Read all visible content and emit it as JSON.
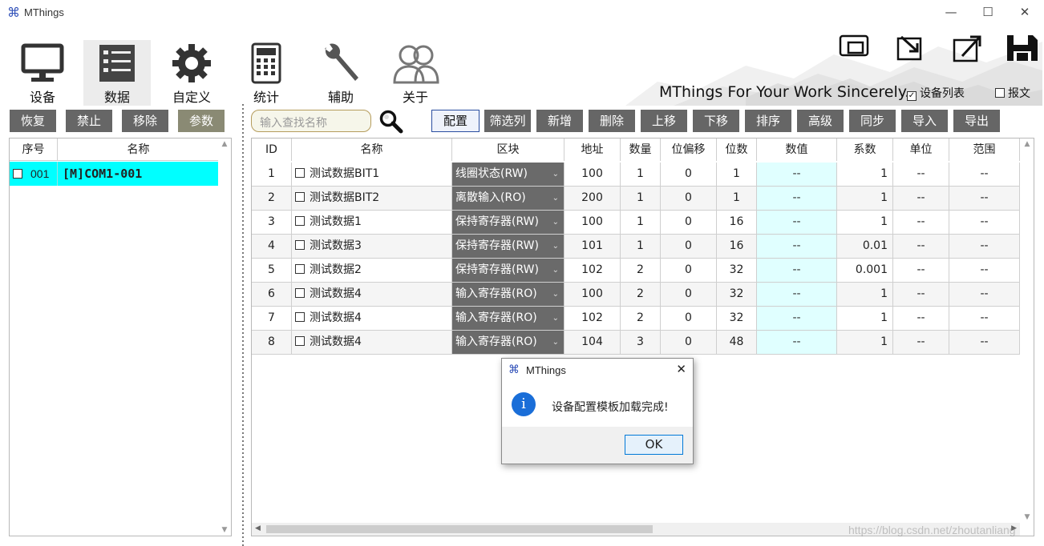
{
  "window": {
    "title": "MThings",
    "minimize": "—",
    "maximize": "☐",
    "close": "✕"
  },
  "nav": {
    "items": [
      {
        "label": "设备",
        "icon": "monitor-icon"
      },
      {
        "label": "数据",
        "icon": "list-icon"
      },
      {
        "label": "自定义",
        "icon": "gear-icon"
      },
      {
        "label": "统计",
        "icon": "calculator-icon"
      },
      {
        "label": "辅助",
        "icon": "wrench-icon"
      },
      {
        "label": "关于",
        "icon": "users-icon"
      }
    ],
    "active": "数据"
  },
  "header": {
    "slogan": "MThings For Your Work Sincerely.",
    "device_list_label": "设备列表",
    "device_list_checked": true,
    "packet_label": "报文",
    "packet_checked": false
  },
  "left_toolbar": {
    "restore": "恢复",
    "disable": "禁止",
    "remove": "移除",
    "params": "参数"
  },
  "left_table": {
    "columns": [
      "序号",
      "名称"
    ],
    "rows": [
      {
        "id": "001",
        "name": "[M]COM1-001",
        "checked": false,
        "selected": true
      }
    ]
  },
  "search": {
    "placeholder": "输入查找名称"
  },
  "right_toolbar": {
    "buttons": [
      "配置",
      "筛选列",
      "新增",
      "删除",
      "上移",
      "下移",
      "排序",
      "高级",
      "同步",
      "导入",
      "导出"
    ],
    "selected": "配置"
  },
  "data_table": {
    "columns": [
      "ID",
      "名称",
      "区块",
      "地址",
      "数量",
      "位偏移",
      "位数",
      "数值",
      "系数",
      "单位",
      "范围"
    ],
    "rows": [
      {
        "id": "1",
        "name": "测试数据BIT1",
        "block": "线圈状态(RW)",
        "addr": "100",
        "count": "1",
        "offset": "0",
        "bits": "1",
        "value": "--",
        "coef": "1",
        "unit": "--",
        "range": "--"
      },
      {
        "id": "2",
        "name": "测试数据BIT2",
        "block": "离散输入(RO)",
        "addr": "200",
        "count": "1",
        "offset": "0",
        "bits": "1",
        "value": "--",
        "coef": "1",
        "unit": "--",
        "range": "--"
      },
      {
        "id": "3",
        "name": "测试数据1",
        "block": "保持寄存器(RW)",
        "addr": "100",
        "count": "1",
        "offset": "0",
        "bits": "16",
        "value": "--",
        "coef": "1",
        "unit": "--",
        "range": "--"
      },
      {
        "id": "4",
        "name": "测试数据3",
        "block": "保持寄存器(RW)",
        "addr": "101",
        "count": "1",
        "offset": "0",
        "bits": "16",
        "value": "--",
        "coef": "0.01",
        "unit": "--",
        "range": "--"
      },
      {
        "id": "5",
        "name": "测试数据2",
        "block": "保持寄存器(RW)",
        "addr": "102",
        "count": "2",
        "offset": "0",
        "bits": "32",
        "value": "--",
        "coef": "0.001",
        "unit": "--",
        "range": "--"
      },
      {
        "id": "6",
        "name": "测试数据4",
        "block": "输入寄存器(RO)",
        "addr": "100",
        "count": "2",
        "offset": "0",
        "bits": "32",
        "value": "--",
        "coef": "1",
        "unit": "--",
        "range": "--"
      },
      {
        "id": "7",
        "name": "测试数据4",
        "block": "输入寄存器(RO)",
        "addr": "102",
        "count": "2",
        "offset": "0",
        "bits": "32",
        "value": "--",
        "coef": "1",
        "unit": "--",
        "range": "--"
      },
      {
        "id": "8",
        "name": "测试数据4",
        "block": "输入寄存器(RO)",
        "addr": "104",
        "count": "3",
        "offset": "0",
        "bits": "48",
        "value": "--",
        "coef": "1",
        "unit": "--",
        "range": "--"
      }
    ]
  },
  "dialog": {
    "title": "MThings",
    "message": "设备配置模板加载完成!",
    "ok": "OK",
    "close": "✕"
  },
  "watermark": "https://blog.csdn.net/zhoutanliang",
  "colors": {
    "button_gray": "#666666",
    "selected_row": "#00ffff",
    "value_cell": "#e0ffff",
    "accent": "#0078d7"
  }
}
